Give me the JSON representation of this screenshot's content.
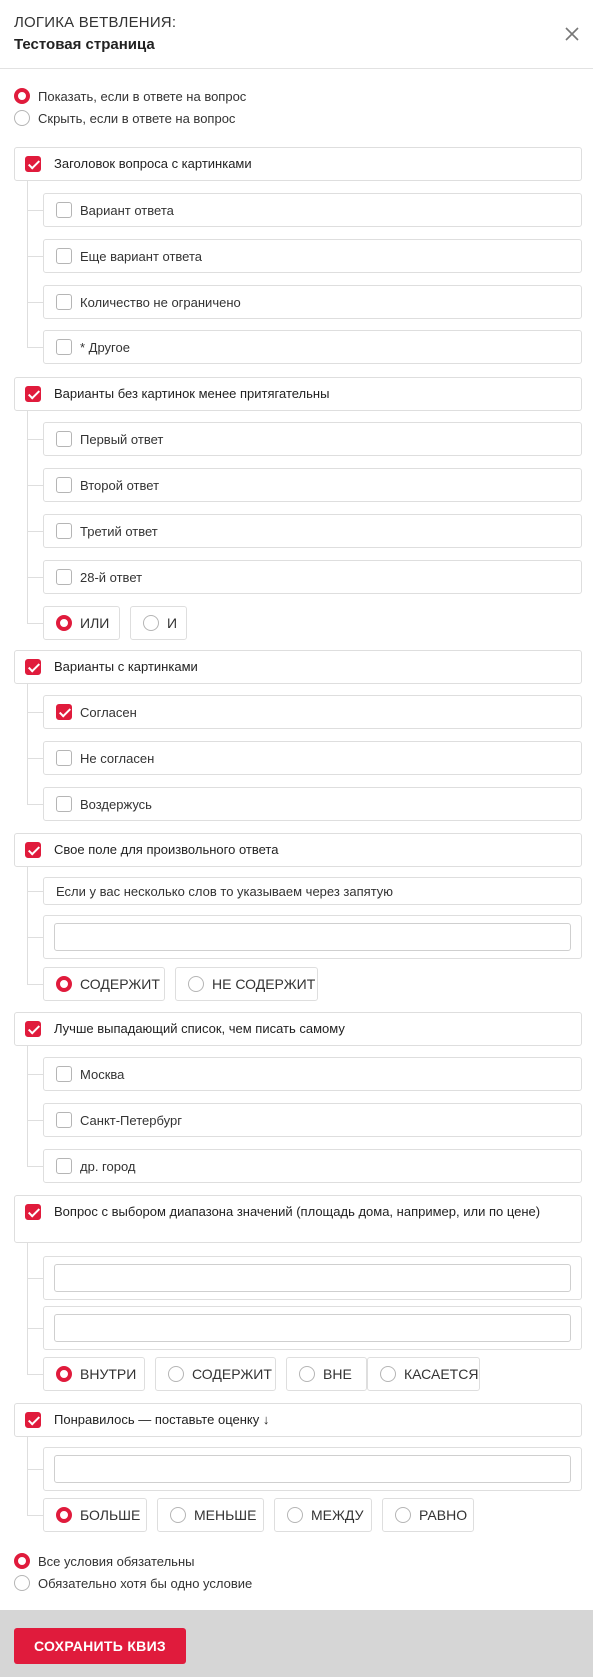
{
  "header": {
    "title": "ЛОГИКА ВЕТВЛЕНИЯ:",
    "subtitle": "Тестовая страница",
    "close_icon": "close-icon"
  },
  "mode": {
    "show_label": "Показать, если в ответе на вопрос",
    "hide_label": "Скрыть, если в ответе на вопрос",
    "selected": "show"
  },
  "questions": [
    {
      "label": "Заголовок вопроса с картинками",
      "checked": true,
      "answers": [
        "Вариант ответа",
        "Еще вариант ответа",
        "Количество не ограничено",
        "* Другое"
      ]
    },
    {
      "label": "Варианты без картинок менее притягательны",
      "checked": true,
      "answers": [
        "Первый ответ",
        "Второй ответ",
        "Третий ответ",
        "28-й ответ"
      ],
      "operators": [
        "ИЛИ",
        "И"
      ],
      "operator_selected": "ИЛИ"
    },
    {
      "label": "Варианты с картинками",
      "checked": true,
      "answers": [
        "Согласен",
        "Не согласен",
        "Воздержусь"
      ],
      "answers_checked": [
        true,
        false,
        false
      ]
    },
    {
      "label": "Свое поле для произвольного ответа",
      "checked": true,
      "hint": "Если у вас несколько слов то указываем через запятую",
      "input_value": "",
      "operators": [
        "СОДЕРЖИТ",
        "НЕ СОДЕРЖИТ"
      ],
      "operator_selected": "СОДЕРЖИТ"
    },
    {
      "label": "Лучше выпадающий список, чем писать самому",
      "checked": true,
      "answers": [
        "Москва",
        "Санкт-Петербург",
        "др. город"
      ]
    },
    {
      "label": "Вопрос с выбором диапазона значений (площадь дома, например, или по цене)",
      "checked": true,
      "input_from": "",
      "input_to": "",
      "operators": [
        "ВНУТРИ",
        "СОДЕРЖИТ",
        "ВНЕ",
        "КАСАЕТСЯ"
      ],
      "operator_selected": "ВНУТРИ"
    },
    {
      "label": "Понравилось — поставьте оценку ↓",
      "checked": true,
      "input_value": "",
      "operators": [
        "БОЛЬШЕ",
        "МЕНЬШЕ",
        "МЕЖДУ",
        "РАВНО"
      ],
      "operator_selected": "БОЛЬШЕ"
    }
  ],
  "conditions": {
    "all_label": "Все условия обязательны",
    "any_label": "Обязательно хотя бы одно условие",
    "selected": "all"
  },
  "footer": {
    "save_label": "СОХРАНИТЬ КВИЗ"
  },
  "colors": {
    "accent": "#e01b3c",
    "border": "#dedede",
    "footer_bg": "#d6d6d6"
  }
}
